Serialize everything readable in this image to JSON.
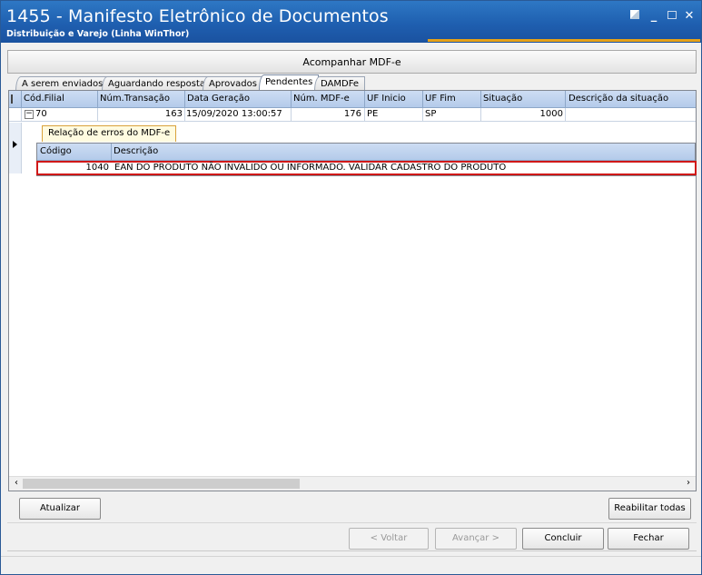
{
  "window": {
    "title": "1455 - Manifesto Eletrônico de Documentos",
    "subtitle": "Distribuição e Varejo (Linha WinThor)"
  },
  "header": {
    "title": "Acompanhar MDF-e"
  },
  "tabs": [
    {
      "label": "A serem enviados",
      "active": false
    },
    {
      "label": "Aguardando resposta",
      "active": false
    },
    {
      "label": "Aprovados",
      "active": false
    },
    {
      "label": "Pendentes",
      "active": true
    },
    {
      "label": "DAMDFe",
      "active": false
    }
  ],
  "grid": {
    "columns": [
      "Cód.Filial",
      "Núm.Transação",
      "Data Geração",
      "Núm. MDF-e",
      "UF Inicio",
      "UF Fim",
      "Situação",
      "Descrição da situação"
    ],
    "rows": [
      {
        "filial": "70",
        "transacao": "163",
        "data": "15/09/2020 13:00:57",
        "mdfe": "176",
        "uf_inicio": "PE",
        "uf_fim": "SP",
        "situacao": "1000",
        "descricao": ""
      }
    ],
    "expander_symbol": "−"
  },
  "detail": {
    "tab_label": "Relação de erros do MDF-e",
    "columns": [
      "Código",
      "Descrição"
    ],
    "rows": [
      {
        "codigo": "1040",
        "descricao": "EAN DO PRODUTO NÃO INVALIDO OU INFORMADO. VALIDAR CADASTRO DO PRODUTO"
      }
    ]
  },
  "buttons": {
    "atualizar": "Atualizar",
    "reabilitar": "Reabilitar todas",
    "voltar": "< Voltar",
    "avancar": "Avançar >",
    "concluir": "Concluir",
    "fechar": "Fechar"
  },
  "colors": {
    "titlebar": "#1f5fb0",
    "accent": "#e6a117",
    "error_highlight": "#d01818"
  }
}
